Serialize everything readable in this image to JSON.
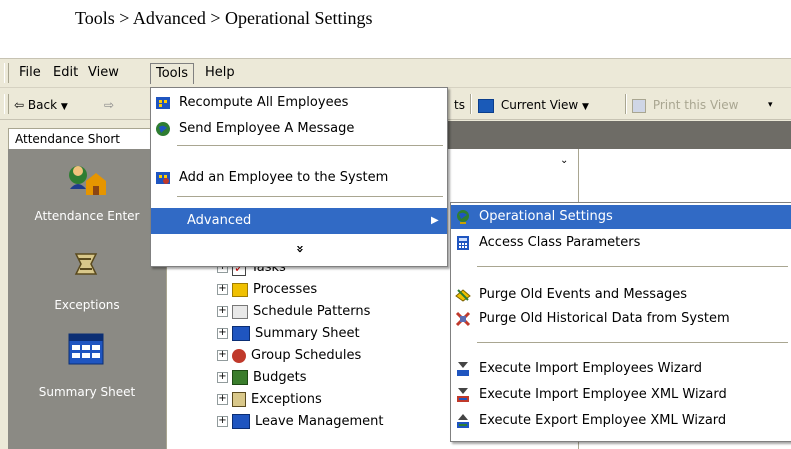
{
  "caption": "Tools > Advanced > Operational Settings",
  "menubar": {
    "items": [
      {
        "label": "File"
      },
      {
        "label": "Edit"
      },
      {
        "label": "View"
      },
      {
        "label": "Tools"
      },
      {
        "label": "Help"
      }
    ]
  },
  "toolbar": {
    "back_label": "Back",
    "partial_label": "ts",
    "current_view_label": "Current View",
    "print_label": "Print this View"
  },
  "tabs": {
    "active_label": "Attendance Short"
  },
  "left_panel": {
    "items": [
      {
        "label": "Attendance Enter",
        "icon": "attendance-icon"
      },
      {
        "label": "Exceptions",
        "icon": "exceptions-icon"
      },
      {
        "label": "Summary Sheet",
        "icon": "summary-sheet-icon"
      }
    ]
  },
  "tree": {
    "items": [
      {
        "label": "Tasks",
        "icon": "tasks-icon"
      },
      {
        "label": "Processes",
        "icon": "processes-icon"
      },
      {
        "label": "Schedule Patterns",
        "icon": "schedule-patterns-icon"
      },
      {
        "label": "Summary Sheet",
        "icon": "summary-sheet-icon"
      },
      {
        "label": "Group Schedules",
        "icon": "group-schedules-icon"
      },
      {
        "label": "Budgets",
        "icon": "budgets-icon"
      },
      {
        "label": "Exceptions",
        "icon": "exceptions-icon"
      },
      {
        "label": "Leave Management",
        "icon": "leave-management-icon"
      }
    ]
  },
  "tools_menu": {
    "items": [
      {
        "label": "Recompute All Employees",
        "icon": "recompute-icon"
      },
      {
        "label": "Send Employee A Message",
        "icon": "globe-message-icon"
      },
      {
        "label": "Add an Employee to the System",
        "icon": "add-employee-icon"
      },
      {
        "label": "Advanced",
        "icon": ""
      }
    ],
    "expand_glyph": "»"
  },
  "advanced_menu": {
    "items": [
      {
        "label": "Operational Settings",
        "icon": "globe-settings-icon"
      },
      {
        "label": "Access Class Parameters",
        "icon": "calculator-icon"
      },
      {
        "label": "Purge Old Events and Messages",
        "icon": "purge-events-icon"
      },
      {
        "label": "Purge Old Historical Data from System",
        "icon": "purge-history-icon"
      },
      {
        "label": "Execute Import Employees Wizard",
        "icon": "import-wizard-icon"
      },
      {
        "label": "Execute Import Employee XML Wizard",
        "icon": "import-xml-icon"
      },
      {
        "label": "Execute Export Employee XML Wizard",
        "icon": "export-xml-icon"
      }
    ]
  },
  "colors": {
    "highlight": "#316ac5",
    "chrome": "#ece9d8",
    "left_panel": "#8b8a84"
  }
}
